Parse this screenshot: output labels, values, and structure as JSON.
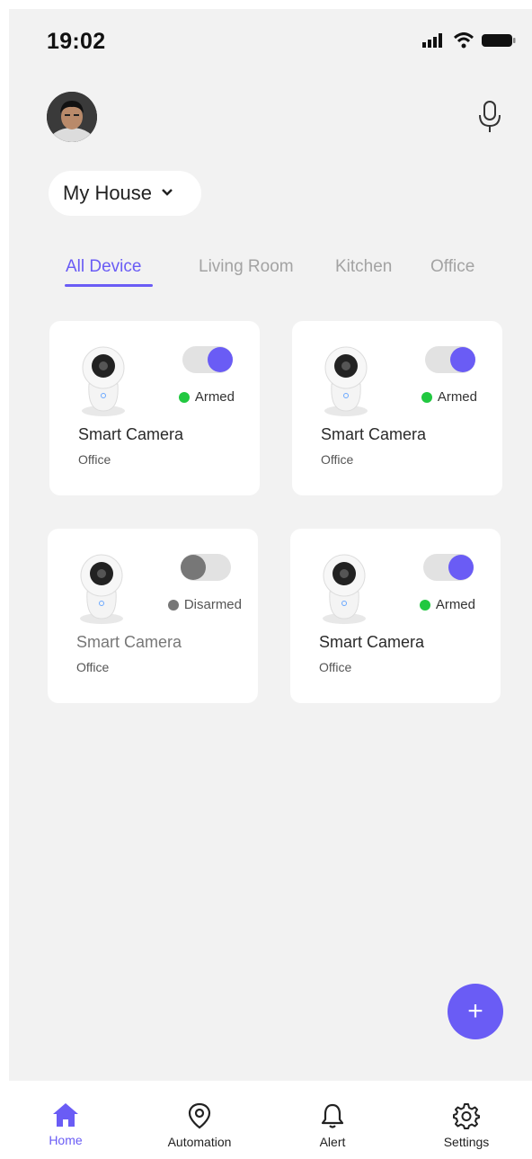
{
  "status_bar": {
    "time": "19:02"
  },
  "header": {
    "house_name": "My House"
  },
  "tabs": [
    {
      "label": "All Device",
      "active": true
    },
    {
      "label": "Living Room",
      "active": false
    },
    {
      "label": "Kitchen",
      "active": false
    },
    {
      "label": "Office",
      "active": false
    }
  ],
  "devices": [
    {
      "name": "Smart Camera",
      "room": "Office",
      "status": "Armed",
      "on": true
    },
    {
      "name": "Smart Camera",
      "room": "Office",
      "status": "Armed",
      "on": true
    },
    {
      "name": "Smart Camera",
      "room": "Office",
      "status": "Disarmed",
      "on": false
    },
    {
      "name": "Smart Camera",
      "room": "Office",
      "status": "Armed",
      "on": true
    }
  ],
  "fab": {
    "label": "+"
  },
  "bottom_nav": [
    {
      "label": "Home",
      "icon": "home-icon",
      "active": true
    },
    {
      "label": "Automation",
      "icon": "location-pin-icon",
      "active": false
    },
    {
      "label": "Alert",
      "icon": "bell-icon",
      "active": false
    },
    {
      "label": "Settings",
      "icon": "gear-icon",
      "active": false
    }
  ],
  "colors": {
    "accent": "#6a5cf5",
    "armed": "#21c840",
    "disarmed": "#777777",
    "background": "#f2f2f2"
  }
}
